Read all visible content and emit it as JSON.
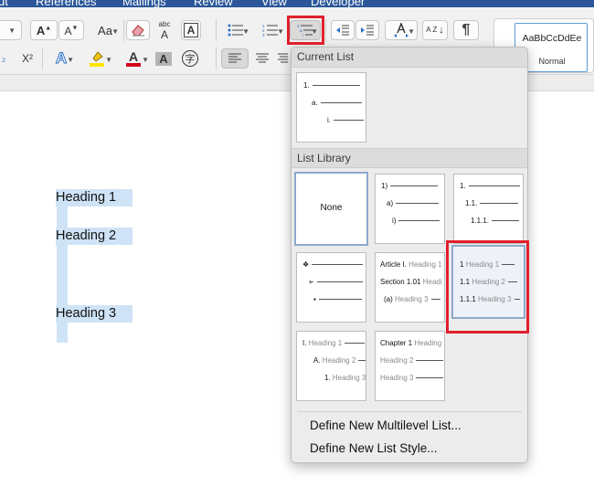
{
  "menubar": {
    "tabs": [
      "ut",
      "References",
      "Mailings",
      "Review",
      "View",
      "Developer"
    ]
  },
  "ribbon": {
    "grow_font": "A",
    "shrink_font": "A",
    "change_case": "Aa",
    "clear_format_icon": "eraser-icon",
    "phonetic_guide": "abc",
    "phonetic_guide_sub": "A",
    "char_border": "A",
    "subscript": "₂",
    "superscript": "X²",
    "text_effects": "A",
    "font_color_letter": "A",
    "font_color": "#d0021b",
    "highlight_color": "#ffe600",
    "char_shading": "A",
    "enclose": "字",
    "sort": "A Z",
    "pilcrow": "¶",
    "style_sample": "AaBbCcDdEe",
    "style_name": "Normal"
  },
  "dropdown": {
    "current_list_label": "Current List",
    "list_library_label": "List Library",
    "current": [
      {
        "num": "1.",
        "text": ""
      },
      {
        "num": "a.",
        "text": ""
      },
      {
        "num": "i.",
        "text": ""
      }
    ],
    "none_label": "None",
    "tile_paren": [
      {
        "num": "1)",
        "text": ""
      },
      {
        "num": "a)",
        "text": ""
      },
      {
        "num": "i)",
        "text": ""
      }
    ],
    "tile_legal": [
      {
        "num": "1.",
        "text": ""
      },
      {
        "num": "1.1.",
        "text": ""
      },
      {
        "num": "1.1.1.",
        "text": ""
      }
    ],
    "tile_bullets": [
      {
        "num": "❖",
        "text": ""
      },
      {
        "num": "➢",
        "text": ""
      },
      {
        "num": "▪",
        "text": ""
      }
    ],
    "tile_article": [
      {
        "num": "Article I.",
        "text": "Heading 1"
      },
      {
        "num": "Section 1.01",
        "text": "Headi"
      },
      {
        "num": "(a)",
        "text": "Heading 3"
      }
    ],
    "tile_heading_num": [
      {
        "num": "1",
        "text": "Heading 1"
      },
      {
        "num": "1.1",
        "text": "Heading 2"
      },
      {
        "num": "1.1.1",
        "text": "Heading 3"
      }
    ],
    "tile_roman": [
      {
        "num": "I.",
        "text": "Heading 1"
      },
      {
        "num": "A.",
        "text": "Heading 2"
      },
      {
        "num": "1.",
        "text": "Heading 3"
      }
    ],
    "tile_chapter": [
      {
        "num": "Chapter 1",
        "text": "Heading"
      },
      {
        "num": "",
        "text": "Heading 2"
      },
      {
        "num": "",
        "text": "Heading 3"
      }
    ],
    "define_multilevel": "Define New Multilevel List...",
    "define_style": "Define New List Style..."
  },
  "document": {
    "headings": [
      "Heading 1",
      "Heading 2",
      "Heading 3"
    ]
  },
  "colors": {
    "highlight_red": "#e0202c",
    "selection_blue": "#cfe3f7",
    "ribbon_blue": "#2b579a"
  }
}
